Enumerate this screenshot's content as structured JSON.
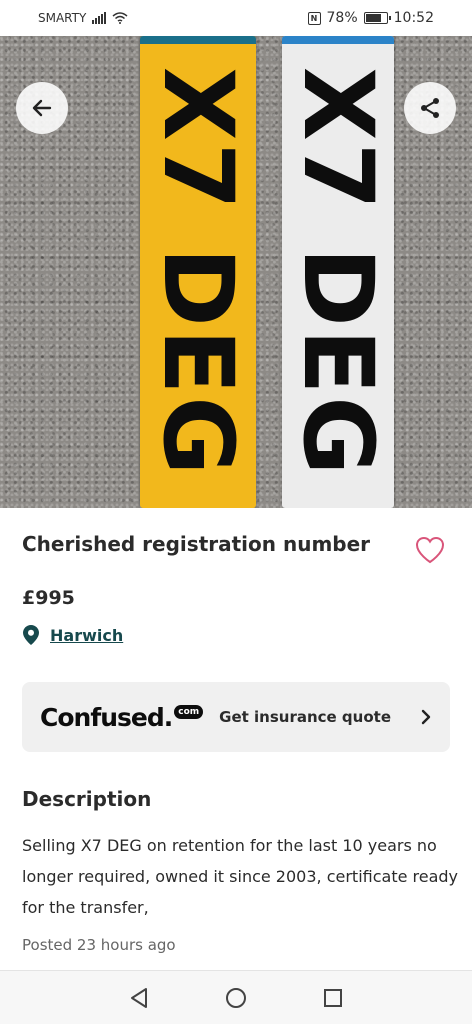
{
  "status_bar": {
    "carrier": "SMARTY",
    "battery_percent": "78%",
    "battery_level": 0.78,
    "time": "10:52",
    "icons": [
      "signal-icon",
      "wifi-icon",
      "nfc-icon",
      "battery-icon"
    ]
  },
  "hero": {
    "plates": [
      {
        "text": "X7 DEG",
        "color": "#f2b81c"
      },
      {
        "text": "X7 DEG",
        "color": "#ececec"
      }
    ],
    "back_icon": "arrow-left-icon",
    "share_icon": "share-icon"
  },
  "listing": {
    "title": "Cherished registration number",
    "price": "£995",
    "location": "Harwich",
    "favourite_icon": "heart-icon",
    "location_icon": "location-pin-icon"
  },
  "insurance": {
    "brand": "Confused.",
    "brand_suffix": "com",
    "cta": "Get insurance quote"
  },
  "description": {
    "heading": "Description",
    "body": "Selling X7 DEG on retention for the last 10 years no longer required, owned it since 2003, certificate ready for the transfer,",
    "posted": "Posted 23 hours ago"
  },
  "colors": {
    "accent_heart": "#d9557a",
    "location_link": "#17494d",
    "card_bg": "#f0f0f0"
  }
}
